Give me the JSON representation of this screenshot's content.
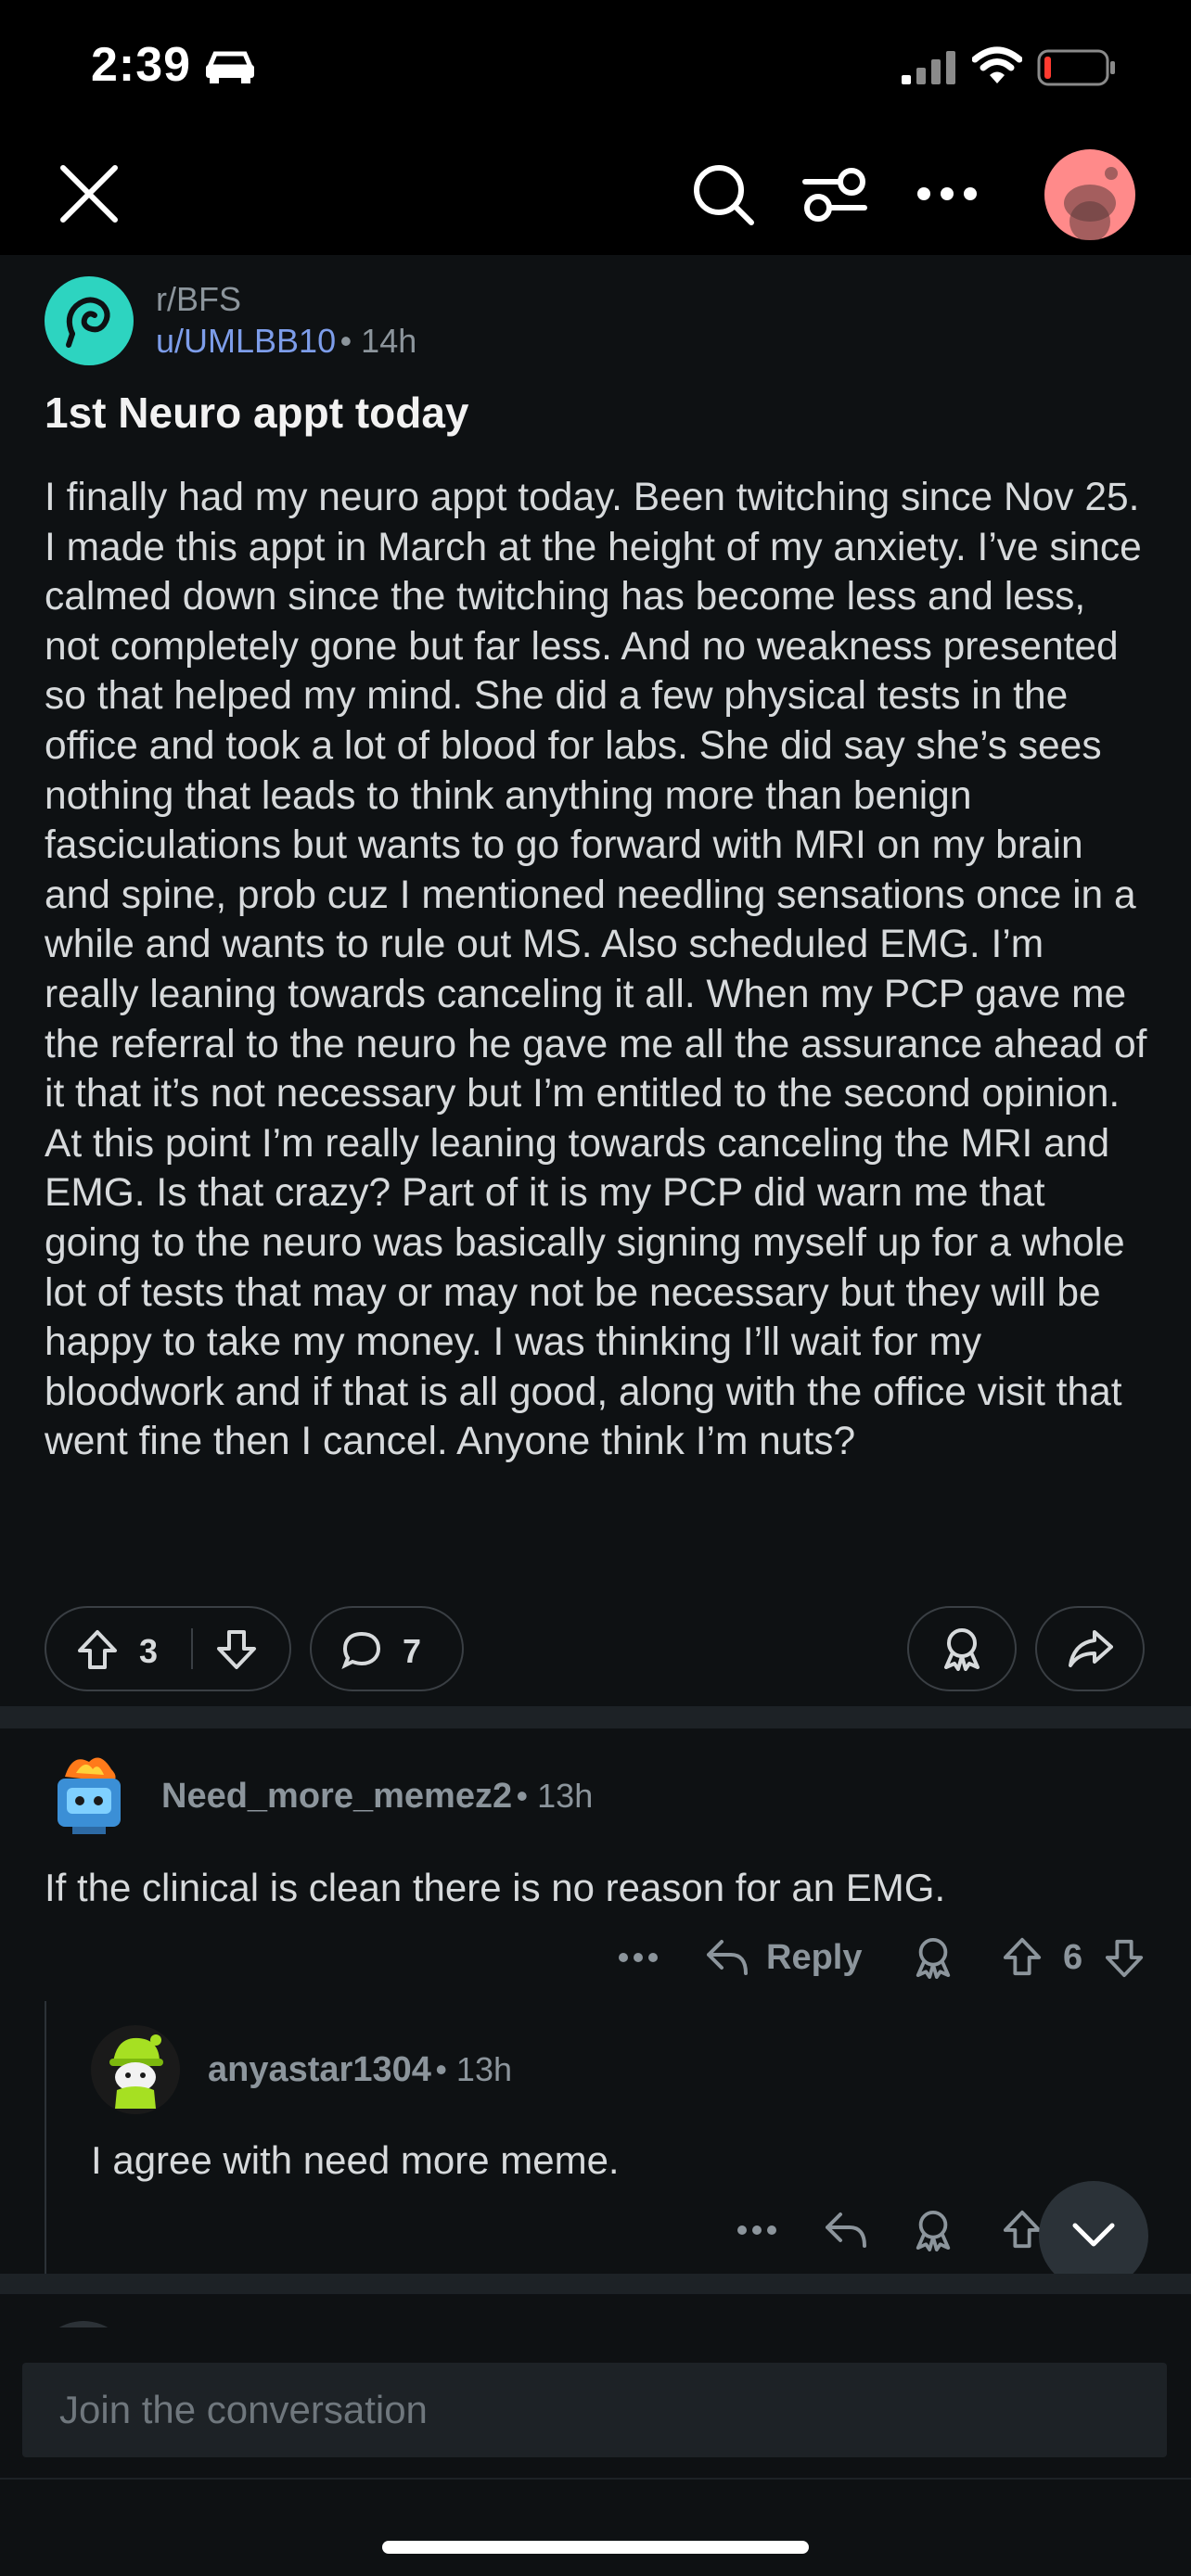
{
  "status_bar": {
    "time": "2:39"
  },
  "post": {
    "subreddit": "r/BFS",
    "author": "u/UMLBB10",
    "age": "14h",
    "title": "1st Neuro appt today",
    "body": "I finally had my neuro appt today. Been twitching since Nov 25. I made this appt in March at the height of my anxiety. I’ve since calmed down since the twitching has become less and less, not completely gone but far less. And no weakness presented so that helped my mind. She did a few physical tests in the office and took a lot of blood for labs. She did say she’s sees nothing that leads to think anything more than benign fasciculations but wants to go forward with MRI on my brain and spine, prob cuz I mentioned needling sensations once in a while and wants to rule out MS. Also scheduled EMG. I’m really leaning towards canceling it all. When my PCP gave me the referral to the neuro he gave me all the assurance ahead of it that it’s not necessary but I’m entitled to the second opinion. At this point I’m really leaning towards canceling the MRI and EMG. Is that crazy? Part of it is my PCP did warn me that going to the neuro was basically signing myself up for a whole lot of tests that may or may not be necessary but they will be happy to take my money. I was thinking I’ll wait for my bloodwork and if that is all good, along with the office visit that went fine then I cancel. Anyone think I’m nuts?",
    "votes": "3",
    "comments_count": "7"
  },
  "comments": [
    {
      "author": "Need_more_memez2",
      "age": "13h",
      "text": "If the clinical is clean there is no reason for an EMG.",
      "reply_label": "Reply",
      "votes": "6"
    },
    {
      "author": "anyastar1304",
      "age": "13h",
      "text": "I agree with need more meme."
    }
  ],
  "composer": {
    "placeholder": "Join the conversation"
  },
  "colors": {
    "background": "#0e1113",
    "link": "#7d9dea",
    "subreddit_icon": "#2dd4c0",
    "avatar": "#ff8a8a"
  }
}
